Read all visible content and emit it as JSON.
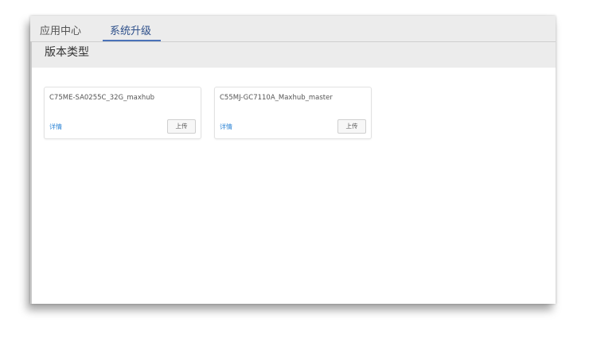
{
  "tabs": [
    {
      "label": "应用中心",
      "active": false
    },
    {
      "label": "系统升级",
      "active": true
    }
  ],
  "section": {
    "title": "版本类型"
  },
  "cards": [
    {
      "name": "C75ME-SA0255C_32G_maxhub",
      "detail_label": "详情",
      "upload_label": "上传"
    },
    {
      "name": "C55MJ-GC7110A_Maxhub_master",
      "detail_label": "详情",
      "upload_label": "上传"
    }
  ],
  "colors": {
    "accent": "#4a72b8",
    "link": "#2f86d6",
    "header_bg": "#ececec"
  }
}
